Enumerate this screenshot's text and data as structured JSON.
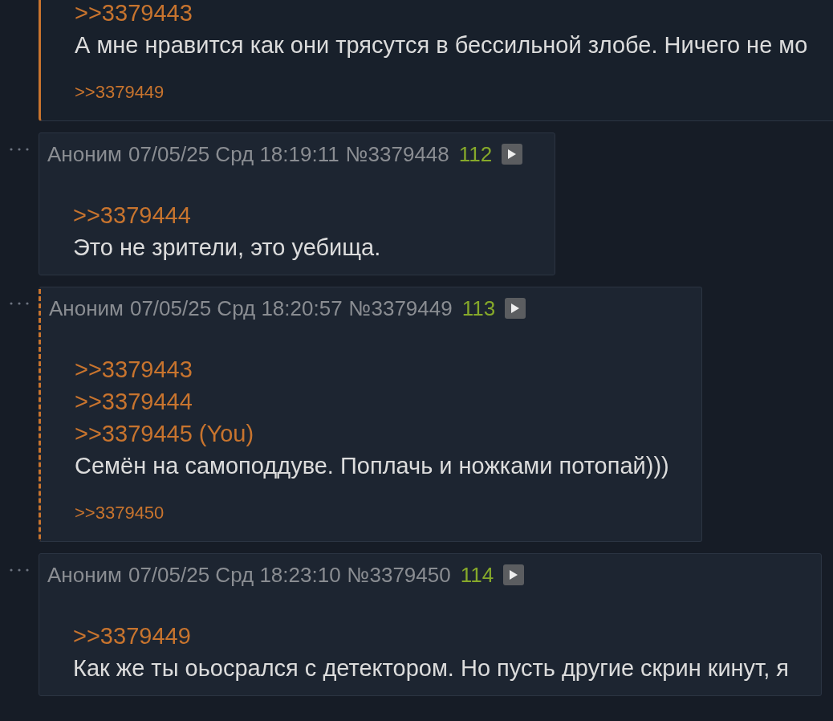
{
  "posts": [
    {
      "kind": "own",
      "quotes": [
        ">>3379443"
      ],
      "text": "А мне нравится как они трясутся в бессильной злобе. Ничего не мо",
      "backlinks": [
        ">>3379449"
      ]
    },
    {
      "kind": "plain",
      "name": "Аноним",
      "date": "07/05/25 Срд 18:19:11",
      "number": "№3379448",
      "count": "112",
      "quotes": [
        ">>3379444"
      ],
      "text": "Это не зрители, это уебища."
    },
    {
      "kind": "reply",
      "name": "Аноним",
      "date": "07/05/25 Срд 18:20:57",
      "number": "№3379449",
      "count": "113",
      "quotes": [
        ">>3379443",
        ">>3379444",
        ">>3379445 (You)"
      ],
      "text": "Семён на самоподдуве. Поплачь и ножками потопай)))",
      "backlinks": [
        ">>3379450"
      ]
    },
    {
      "kind": "plain",
      "name": "Аноним",
      "date": "07/05/25 Срд 18:23:10",
      "number": "№3379450",
      "count": "114",
      "quotes": [
        ">>3379449"
      ],
      "text": "Как же ты оьосрался с детектором. Но пусть другие скрин кинут, я"
    }
  ]
}
